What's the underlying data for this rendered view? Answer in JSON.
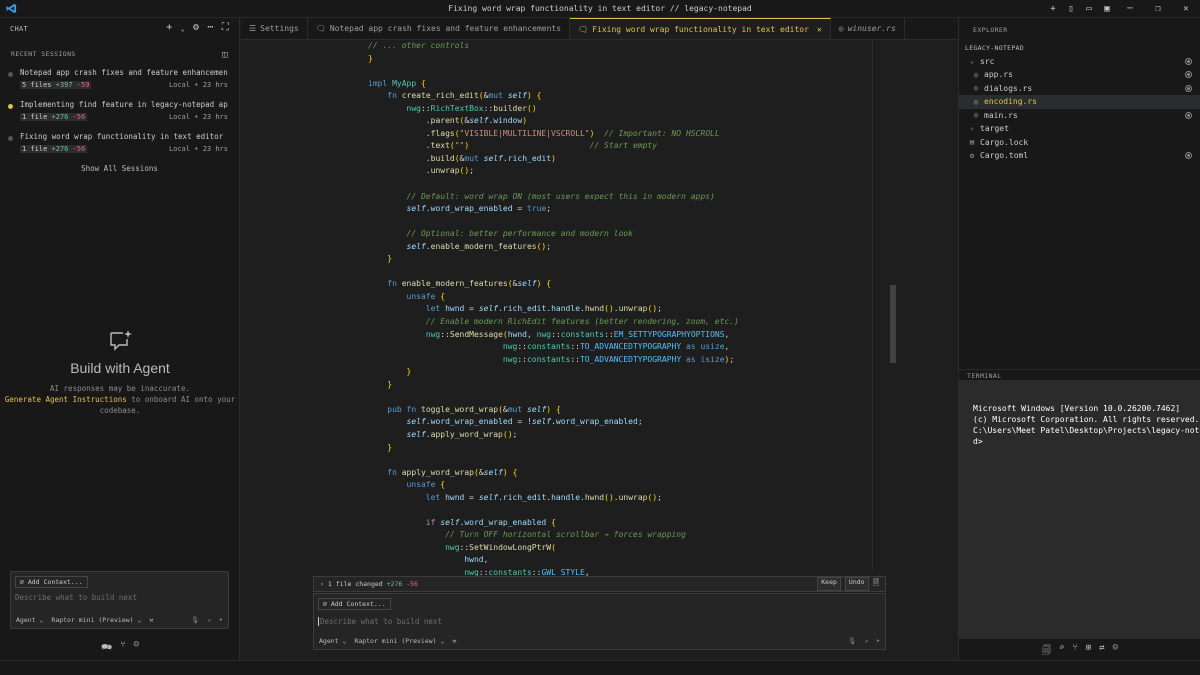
{
  "window": {
    "title": "Fixing word wrap functionality in text editor // legacy-notepad"
  },
  "chat": {
    "header_label": "CHAT",
    "recent_sessions_label": "RECENT SESSIONS",
    "sessions": [
      {
        "name": "Notepad app crash fixes and feature enhancements",
        "files": "5 files",
        "add": "+397",
        "del": "-59",
        "location": "Local • 23 hrs",
        "active": false
      },
      {
        "name": "Implementing find feature in legacy-notepad applica...",
        "files": "1 file",
        "add": "+276",
        "del": "-56",
        "location": "Local • 23 hrs",
        "active": true
      },
      {
        "name": "Fixing word wrap functionality in text editor",
        "files": "1 file",
        "add": "+276",
        "del": "-56",
        "location": "Local • 23 hrs",
        "active": false
      }
    ],
    "show_all": "Show All Sessions",
    "agent_title": "Build with Agent",
    "agent_note": "AI responses may be inaccurate.",
    "agent_link": "Generate Agent Instructions",
    "agent_link_rest": "to onboard AI onto your",
    "agent_link_rest2": "codebase.",
    "add_context": "Add Context...",
    "placeholder": "Describe what to build next",
    "mode": "Agent",
    "model": "Raptor mini (Preview)"
  },
  "tabs": [
    {
      "label": "Settings",
      "icon": "settings-icon",
      "active": false
    },
    {
      "label": "Notepad app crash fixes and feature enhancements",
      "icon": "chat-icon",
      "active": false
    },
    {
      "label": "Fixing word wrap functionality in text editor",
      "icon": "chat-icon",
      "active": true
    },
    {
      "label": "winuser.rs",
      "icon": "rust-file-icon",
      "active": false
    }
  ],
  "editor": {
    "changes_summary": "1 file changed",
    "changes_add": "+276",
    "changes_del": "-56",
    "keep_label": "Keep",
    "undo_label": "Undo",
    "add_context": "Add Context...",
    "placeholder": "Describe what to build next",
    "mode": "Agent",
    "model": "Raptor mini (Preview)",
    "code_lines": [
      "// ... other controls",
      "}",
      "",
      "impl MyApp {",
      "    fn create_rich_edit(&mut self) {",
      "        nwg::RichTextBox::builder()",
      "            .parent(&self.window)",
      "            .flags(\"VISIBLE|MULTILINE|VSCROLL\")  // Important: NO HSCROLL",
      "            .text(\"\")                         // Start empty",
      "            .build(&mut self.rich_edit)",
      "            .unwrap();",
      "",
      "        // Default: word wrap ON (most users expect this in modern apps)",
      "        self.word_wrap_enabled = true;",
      "",
      "        // Optional: better performance and modern look",
      "        self.enable_modern_features();",
      "    }",
      "",
      "    fn enable_modern_features(&self) {",
      "        unsafe {",
      "            let hwnd = self.rich_edit.handle.hwnd().unwrap();",
      "            // Enable modern RichEdit features (better rendering, zoom, etc.)",
      "            nwg::SendMessage(hwnd, nwg::constants::EM_SETTYPOGRAPHYOPTIONS,",
      "                            nwg::constants::TO_ADVANCEDTYPOGRAPHY as usize,",
      "                            nwg::constants::TO_ADVANCEDTYPOGRAPHY as isize);",
      "        }",
      "    }",
      "",
      "    pub fn toggle_word_wrap(&mut self) {",
      "        self.word_wrap_enabled = !self.word_wrap_enabled;",
      "        self.apply_word_wrap();",
      "    }",
      "",
      "    fn apply_word_wrap(&self) {",
      "        unsafe {",
      "            let hwnd = self.rich_edit.handle.hwnd().unwrap();",
      "",
      "            if self.word_wrap_enabled {",
      "                // Turn OFF horizontal scrollbar → forces wrapping",
      "                nwg::SetWindowLongPtrW(",
      "                    hwnd,",
      "                    nwg::constants::GWL_STYLE,"
    ]
  },
  "explorer": {
    "header": "EXPLORER",
    "project": "LEGACY-NOTEPAD",
    "items": [
      {
        "label": "src",
        "kind": "folder-open",
        "depth": 1,
        "badge": true,
        "selected": false
      },
      {
        "label": "app.rs",
        "kind": "rust",
        "depth": 2,
        "badge": true,
        "selected": false
      },
      {
        "label": "dialogs.rs",
        "kind": "rust",
        "depth": 2,
        "badge": true,
        "selected": false
      },
      {
        "label": "encoding.rs",
        "kind": "rust",
        "depth": 2,
        "badge": false,
        "selected": true
      },
      {
        "label": "main.rs",
        "kind": "rust",
        "depth": 2,
        "badge": true,
        "selected": false
      },
      {
        "label": "target",
        "kind": "folder",
        "depth": 1,
        "badge": false,
        "selected": false
      },
      {
        "label": "Cargo.lock",
        "kind": "file",
        "depth": 1,
        "badge": false,
        "selected": false
      },
      {
        "label": "Cargo.toml",
        "kind": "gear",
        "depth": 1,
        "badge": true,
        "selected": false
      }
    ]
  },
  "terminal": {
    "header": "TERMINAL",
    "lines": [
      "Microsoft Windows [Version 10.0.26200.7462]",
      "(c) Microsoft Corporation. All rights reserved.",
      "",
      "C:\\Users\\Meet Patel\\Desktop\\Projects\\legacy-notepad",
      "d>"
    ]
  },
  "colors": {
    "accent": "#e2c04a",
    "background": "#1e1e1e",
    "panel": "#181818"
  }
}
